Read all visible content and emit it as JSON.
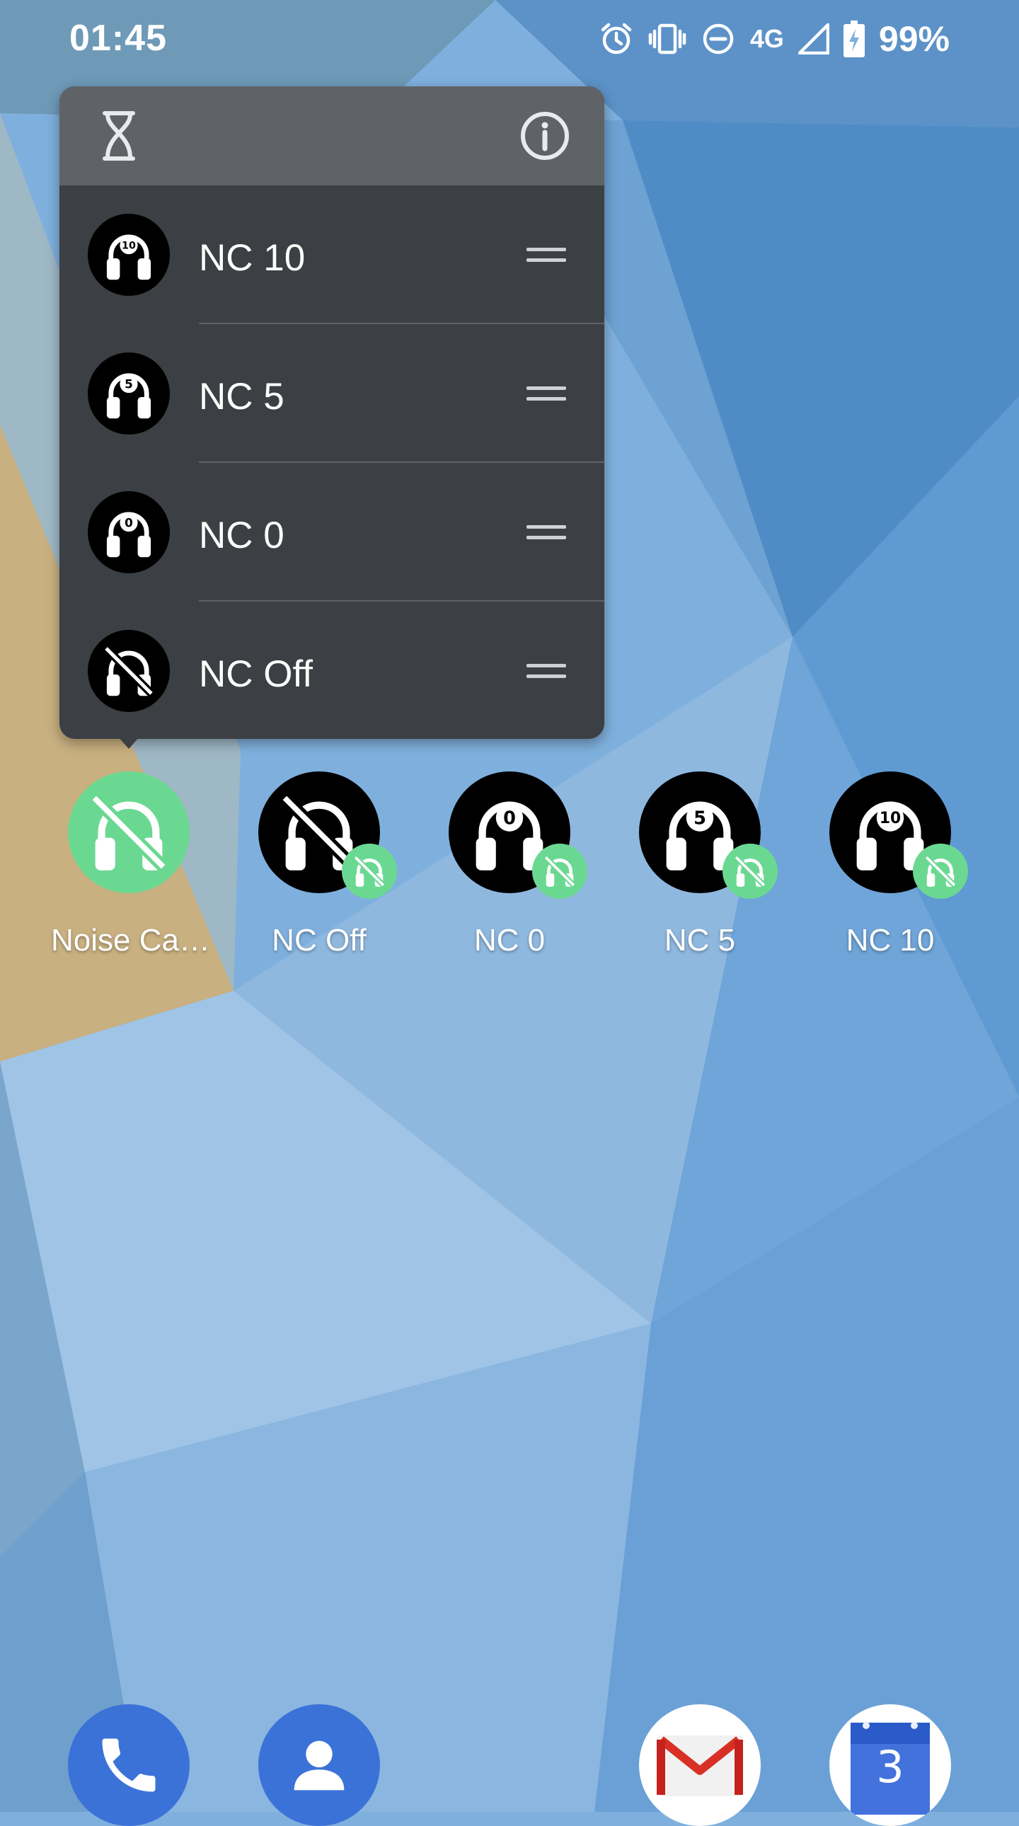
{
  "status_bar": {
    "time": "01:45",
    "network": "4G",
    "battery": "99%",
    "icons": [
      "alarm-icon",
      "vibrate-icon",
      "do-not-disturb-icon",
      "signal-icon",
      "battery-charging-icon"
    ]
  },
  "popup": {
    "header_icons": [
      "hourglass-icon",
      "info-icon"
    ],
    "items": [
      {
        "label": "NC 10",
        "badge": "10",
        "icon": "headphones-10-icon"
      },
      {
        "label": "NC 5",
        "badge": "5",
        "icon": "headphones-5-icon"
      },
      {
        "label": "NC 0",
        "badge": "0",
        "icon": "headphones-0-icon"
      },
      {
        "label": "NC Off",
        "badge": "",
        "icon": "headphones-off-icon"
      }
    ]
  },
  "shortcuts": [
    {
      "label": "Noise Ca…",
      "badge": "",
      "icon": "noise-cancelling-app-icon"
    },
    {
      "label": "NC Off",
      "badge": "",
      "icon": "headphones-off-icon"
    },
    {
      "label": "NC 0",
      "badge": "0",
      "icon": "headphones-0-icon"
    },
    {
      "label": "NC 5",
      "badge": "5",
      "icon": "headphones-5-icon"
    },
    {
      "label": "NC 10",
      "badge": "10",
      "icon": "headphones-10-icon"
    }
  ],
  "dock": {
    "apps": [
      {
        "name": "Phone",
        "icon": "phone-icon"
      },
      {
        "name": "Contacts",
        "icon": "contacts-icon"
      },
      {
        "name": "Gmail",
        "icon": "gmail-icon"
      },
      {
        "name": "Calendar",
        "icon": "calendar-icon"
      }
    ],
    "calendar_day": "3"
  },
  "colors": {
    "wallpaper_base": "#7fb0dd",
    "popup_body": "#3c3f43",
    "popup_header": "#5f6368",
    "app_green": "#6bd892",
    "dock_blue": "#3a72d8"
  }
}
